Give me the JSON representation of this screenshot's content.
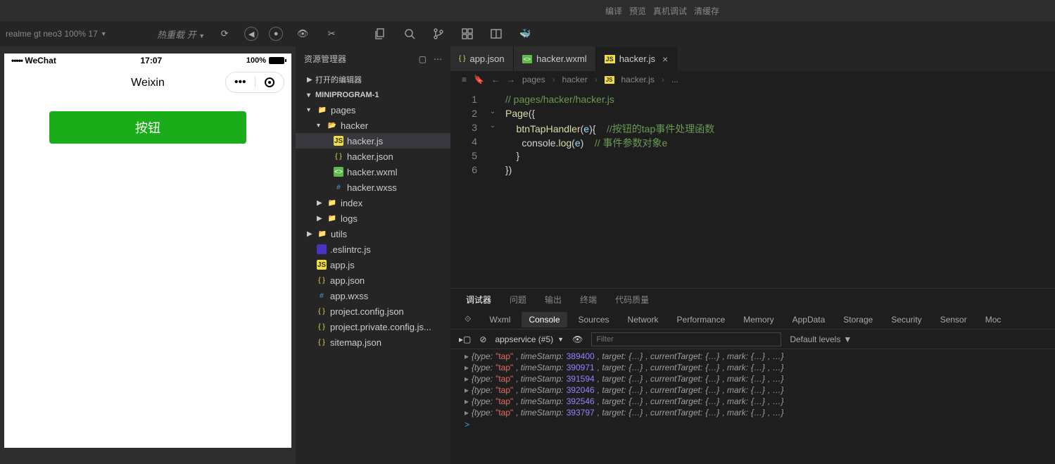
{
  "toolbar": {
    "device": "realme gt neo3 100% 17",
    "hotreload": "热重载 开"
  },
  "sim": {
    "carrier": "WeChat",
    "time": "17:07",
    "battery": "100%",
    "title": "Weixin",
    "button": "按钮"
  },
  "explorer": {
    "title": "资源管理器",
    "sections": {
      "editors": "打开的编辑器",
      "project": "MINIPROGRAM-1"
    },
    "tree": {
      "pages": "pages",
      "hacker": "hacker",
      "files": {
        "hackerjs": "hacker.js",
        "hackerjson": "hacker.json",
        "hackerwxml": "hacker.wxml",
        "hackerwxss": "hacker.wxss",
        "index": "index",
        "logs": "logs",
        "utils": "utils",
        "eslint": ".eslintrc.js",
        "appjs": "app.js",
        "appjson": "app.json",
        "appwxss": "app.wxss",
        "projcfg": "project.config.json",
        "projpriv": "project.private.config.js...",
        "sitemap": "sitemap.json"
      }
    }
  },
  "tabs": {
    "t1": "app.json",
    "t2": "hacker.wxml",
    "t3": "hacker.js"
  },
  "breadcrumb": {
    "p1": "pages",
    "p2": "hacker",
    "p3": "hacker.js",
    "p4": "..."
  },
  "code": {
    "l1": "// pages/hacker/hacker.js",
    "l2a": "Page",
    "l2b": "({",
    "l3a": "    btnTapHandler",
    "l3b": "(",
    "l3c": "e",
    "l3d": "){    ",
    "l3e": "//按钮的tap事件处理函数",
    "l4a": "      console.",
    "l4b": "log",
    "l4c": "(",
    "l4d": "e",
    "l4e": ")    ",
    "l4f": "// 事件参数对象e",
    "l5": "    }",
    "l6": "})"
  },
  "panel": {
    "tabs": {
      "debugger": "调试器",
      "problems": "问题",
      "output": "输出",
      "terminal": "终端",
      "quality": "代码质量"
    },
    "dtabs": {
      "wxml": "Wxml",
      "console": "Console",
      "sources": "Sources",
      "network": "Network",
      "performance": "Performance",
      "memory": "Memory",
      "appdata": "AppData",
      "storage": "Storage",
      "security": "Security",
      "sensor": "Sensor",
      "mock": "Moc"
    },
    "context": "appservice (#5)",
    "filter_ph": "Filter",
    "levels": "Default levels",
    "logs": [
      {
        "ts": "389400"
      },
      {
        "ts": "390971"
      },
      {
        "ts": "391594"
      },
      {
        "ts": "392046"
      },
      {
        "ts": "392546"
      },
      {
        "ts": "393797"
      }
    ]
  }
}
